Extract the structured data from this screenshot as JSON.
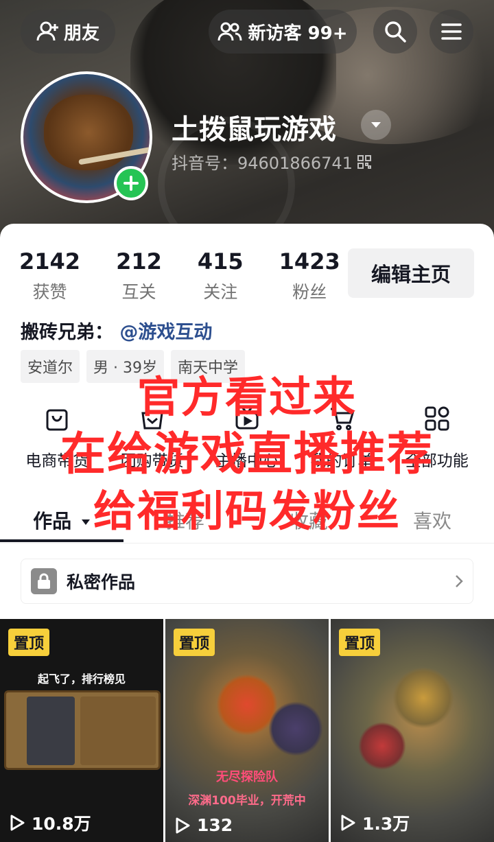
{
  "header": {
    "friends_label": "朋友",
    "visitors_label": "新访客 99+",
    "username": "土拨鼠玩游戏",
    "douyin_id": "抖音号：94601866741"
  },
  "stats": [
    {
      "value": "2142",
      "label": "获赞"
    },
    {
      "value": "212",
      "label": "互关"
    },
    {
      "value": "415",
      "label": "关注"
    },
    {
      "value": "1423",
      "label": "粉丝"
    }
  ],
  "edit_profile_label": "编辑主页",
  "bio": {
    "prefix": "搬砖兄弟：",
    "mention": "@游戏互动"
  },
  "tags": [
    "安道尔",
    "男 · 39岁",
    "南天中学"
  ],
  "functions": [
    {
      "label": "电商带货",
      "icon": "shop-bag-icon"
    },
    {
      "label": "团购带货",
      "icon": "group-buy-icon"
    },
    {
      "label": "主播中心",
      "icon": "streamer-center-icon"
    },
    {
      "label": "我的订单",
      "icon": "cart-icon"
    },
    {
      "label": "全部功能",
      "icon": "all-functions-icon"
    }
  ],
  "tabs": [
    "作品",
    "推荐",
    "收藏",
    "喜欢"
  ],
  "private_works_label": "私密作品",
  "videos": [
    {
      "pinned": "置顶",
      "plays": "10.8万",
      "caption": "起飞了，排行榜见"
    },
    {
      "pinned": "置顶",
      "plays": "132",
      "caption": "无尽探险队",
      "subcaption": "深渊100毕业，开荒中"
    },
    {
      "pinned": "置顶",
      "plays": "1.3万"
    }
  ],
  "overlay": {
    "line1": "官方看过来",
    "line2": "在给游戏直播推荐",
    "line3": "给福利码发粉丝"
  },
  "colors": {
    "accent_green": "#25c454",
    "mention_blue": "#2d4f8f",
    "pin_yellow": "#f7cf3b",
    "overlay_red": "#ff2a2a"
  }
}
